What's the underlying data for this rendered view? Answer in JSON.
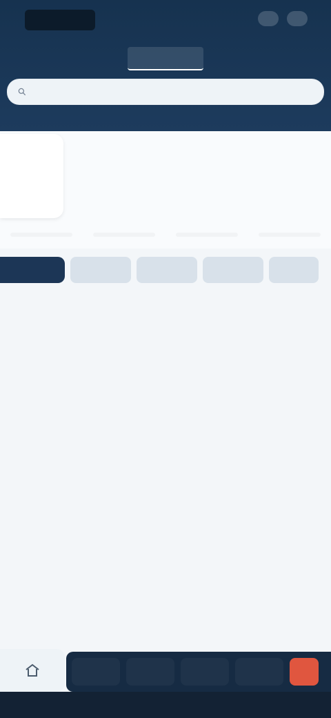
{
  "header": {
    "brand": "",
    "top_actions": [
      "",
      ""
    ],
    "tabs": [
      {
        "label": ""
      },
      {
        "label": ""
      },
      {
        "label": ""
      }
    ],
    "search": {
      "placeholder": ""
    }
  },
  "profile": {
    "name": "",
    "role": "",
    "date": "",
    "link": "",
    "stats": [
      "",
      "",
      "",
      ""
    ]
  },
  "segments": [
    "",
    "",
    "",
    "",
    ""
  ],
  "segment_caption": "",
  "content": {
    "rows": [
      {
        "left": "",
        "right": ""
      },
      {
        "left": "",
        "right": ""
      },
      {
        "left": "",
        "sub": "",
        "right": ""
      },
      {
        "left": "",
        "right": ""
      },
      {
        "left": "",
        "sub": "",
        "right": ""
      }
    ],
    "labels": [
      "",
      "",
      "",
      ""
    ]
  },
  "bottom_nav": {
    "buttons": [
      "",
      "",
      "",
      ""
    ],
    "alert": ""
  },
  "colors": {
    "primary": "#1c3656",
    "accent": "#e0563f",
    "background": "#f3f6f9"
  }
}
